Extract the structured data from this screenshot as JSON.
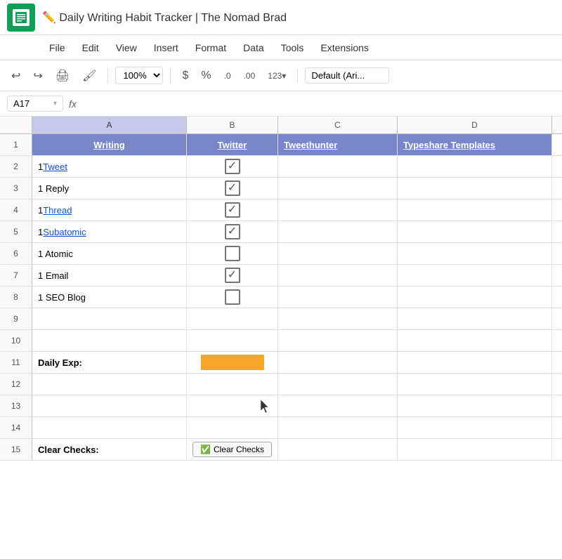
{
  "title": {
    "icon": "📝",
    "text": "Daily Writing Habit Tracker | The Nomad Brad",
    "app_icon_lines": "≡"
  },
  "menu": {
    "items": [
      "File",
      "Edit",
      "View",
      "Insert",
      "Format",
      "Data",
      "Tools",
      "Extensions"
    ]
  },
  "toolbar": {
    "undo": "↩",
    "redo": "↪",
    "print": "🖨",
    "paint": "🖌",
    "zoom": "100%",
    "currency": "$",
    "percent": "%",
    "decimal_less": ".0",
    "decimal_more": ".00",
    "more_formats": "123▾",
    "font": "Default (Ari..."
  },
  "formula_bar": {
    "cell_ref": "A17",
    "fx": "fx"
  },
  "columns": {
    "row_num": "",
    "headers": [
      "A",
      "B",
      "C",
      "D"
    ]
  },
  "header_row": {
    "row_num": "1",
    "col_a": "Writing",
    "col_b": "Twitter",
    "col_c": "Tweethunter",
    "col_d": "Typeshare Templates"
  },
  "rows": [
    {
      "num": "2",
      "col_a": "1 Tweet",
      "col_a_link": true,
      "col_b_checked": true,
      "col_b_empty": false
    },
    {
      "num": "3",
      "col_a": "1 Reply",
      "col_a_link": false,
      "col_b_checked": true,
      "col_b_empty": false
    },
    {
      "num": "4",
      "col_a": "1 Thread",
      "col_a_link": true,
      "col_b_checked": true,
      "col_b_empty": false
    },
    {
      "num": "5",
      "col_a": "1 Subatomic",
      "col_a_link": true,
      "col_b_checked": true,
      "col_b_empty": false
    },
    {
      "num": "6",
      "col_a": "1 Atomic",
      "col_a_link": false,
      "col_b_checked": false,
      "col_b_empty": false
    },
    {
      "num": "7",
      "col_a": "1 Email",
      "col_a_link": false,
      "col_b_checked": true,
      "col_b_empty": false
    },
    {
      "num": "8",
      "col_a": "1 SEO Blog",
      "col_a_link": false,
      "col_b_checked": false,
      "col_b_empty": false
    },
    {
      "num": "9",
      "col_a": "",
      "col_a_link": false,
      "col_b_checked": null
    },
    {
      "num": "10",
      "col_a": "",
      "col_a_link": false,
      "col_b_checked": null
    }
  ],
  "special_rows": {
    "daily_exp": {
      "row_num": "11",
      "label": "Daily Exp:"
    },
    "empty_rows": [
      "12",
      "13",
      "14"
    ],
    "clear_checks": {
      "row_num": "15",
      "label": "Clear Checks:",
      "button_icon": "✅",
      "button_text": "Clear Checks"
    }
  },
  "colors": {
    "header_bg": "#7986cb",
    "header_text": "#ffffff",
    "orange": "#f4a626",
    "link": "#1155cc",
    "selected_border": "#1a73e8",
    "col_a_bg": "#e8eaf6"
  }
}
